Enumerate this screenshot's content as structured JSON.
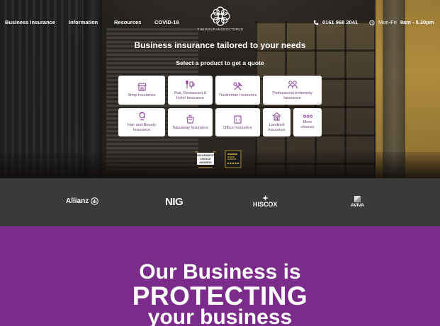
{
  "nav": {
    "links": [
      "Business Insurance",
      "Information",
      "Resources",
      "COVID-19"
    ],
    "logo_text": "THEINSURANCEOCTOPUS",
    "phone": "0161 968 2041",
    "hours_days": "Mon-Fri",
    "hours_time": "9am - 5.30pm"
  },
  "hero": {
    "headline": "Business insurance tailored to your needs",
    "subhead": "Select a product to get a quote"
  },
  "products": [
    {
      "label": "Shop Insurance",
      "icon": "shop-icon"
    },
    {
      "label": "Pub, Restaurant & Hotel Insurance",
      "icon": "pub-icon"
    },
    {
      "label": "Tradesman Insurance",
      "icon": "tools-icon"
    },
    {
      "label": "Professional Indemnity Insurance",
      "icon": "people-icon"
    },
    {
      "label": "Hair and Beauty Insurance",
      "icon": "hair-icon"
    },
    {
      "label": "Takeaway Insurance",
      "icon": "takeaway-icon"
    },
    {
      "label": "Office Insurance",
      "icon": "office-icon"
    },
    {
      "label": "Landlord Insurance",
      "icon": "landlord-icon"
    },
    {
      "label": "More choices",
      "icon": "dots-icon"
    }
  ],
  "badges": {
    "award_lines": [
      "INSURANCE",
      "CHOICE",
      "AWARDS"
    ]
  },
  "partners": [
    "Allianz",
    "NIG",
    "HISCOX",
    "AVIVA"
  ],
  "promo": {
    "line1": "Our Business is",
    "line2": "PROTECTING",
    "line3": "your business"
  },
  "colors": {
    "brand_purple": "#7b2c8b",
    "logo_bar": "#3a3a3a",
    "tile_text": "#6a4a70"
  }
}
